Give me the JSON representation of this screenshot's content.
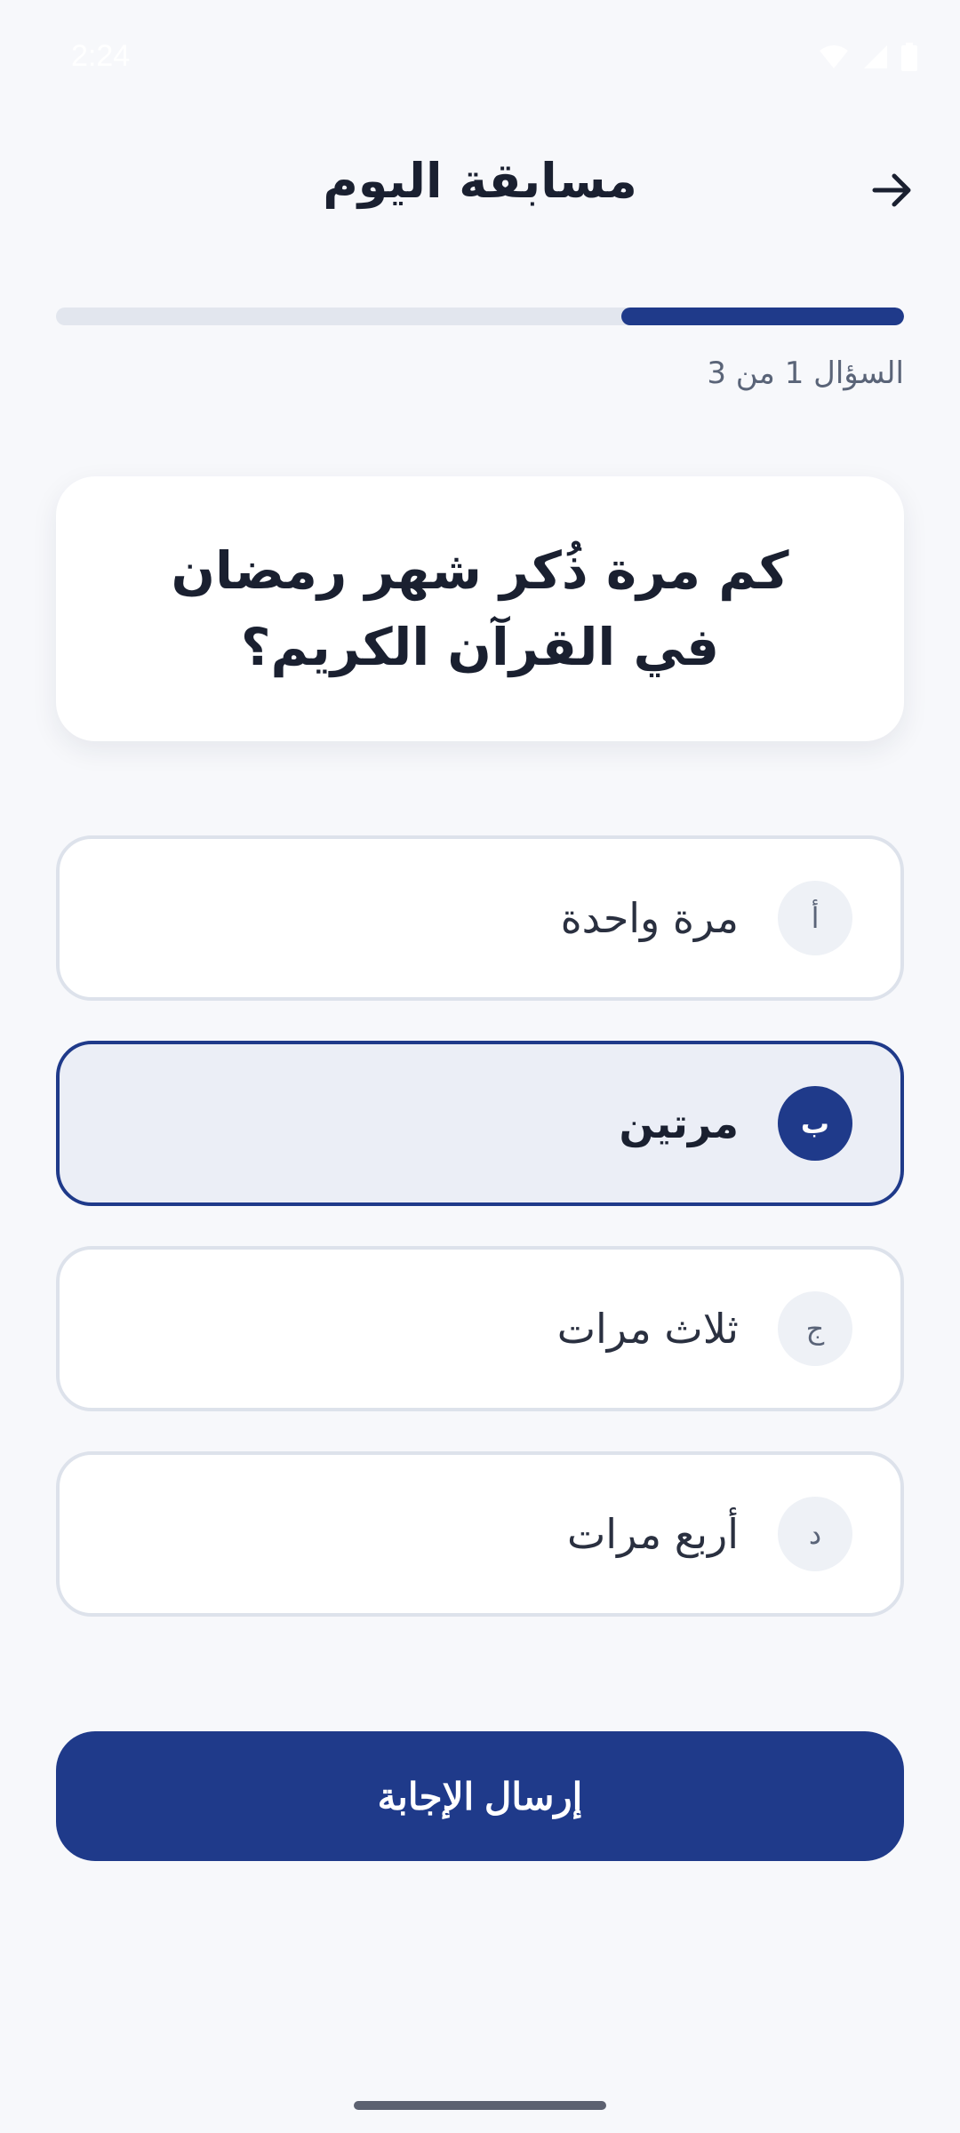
{
  "status_bar": {
    "time": "2:24",
    "icons": [
      "wifi-icon",
      "signal-icon",
      "battery-icon"
    ]
  },
  "header": {
    "title": "مسابقة اليوم",
    "back_icon": "arrow-right-icon"
  },
  "progress": {
    "label": "السؤال 1 من 3",
    "current": 1,
    "total": 3,
    "fraction": 0.333
  },
  "question": {
    "text": "كم مرة ذُكر شهر رمضان في القرآن الكريم؟"
  },
  "options": [
    {
      "letter": "أ",
      "text": "مرة واحدة",
      "selected": false
    },
    {
      "letter": "ب",
      "text": "مرتين",
      "selected": true
    },
    {
      "letter": "ج",
      "text": "ثلاث مرات",
      "selected": false
    },
    {
      "letter": "د",
      "text": "أربع مرات",
      "selected": false
    }
  ],
  "submit": {
    "label": "إرسال الإجابة"
  },
  "colors": {
    "accent": "#1F3A8A",
    "background": "#F7F8FB",
    "card": "#FFFFFF",
    "selected_bg": "#EBEEF6",
    "border": "#DDE2EB"
  }
}
